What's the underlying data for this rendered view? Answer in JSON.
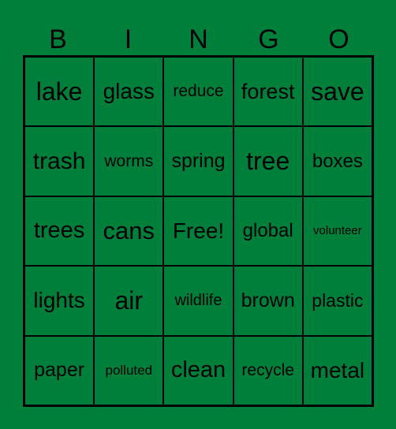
{
  "card": {
    "background_color": "#007f3a",
    "header": [
      "B",
      "I",
      "N",
      "G",
      "O"
    ],
    "cells": [
      [
        "lake",
        "glass",
        "reduce",
        "forest",
        "save"
      ],
      [
        "trash",
        "worms",
        "spring",
        "tree",
        "boxes"
      ],
      [
        "trees",
        "cans",
        "Free!",
        "global",
        "volunteer"
      ],
      [
        "lights",
        "air",
        "wildlife",
        "brown",
        "plastic"
      ],
      [
        "paper",
        "polluted",
        "clean",
        "recycle",
        "metal"
      ]
    ]
  }
}
